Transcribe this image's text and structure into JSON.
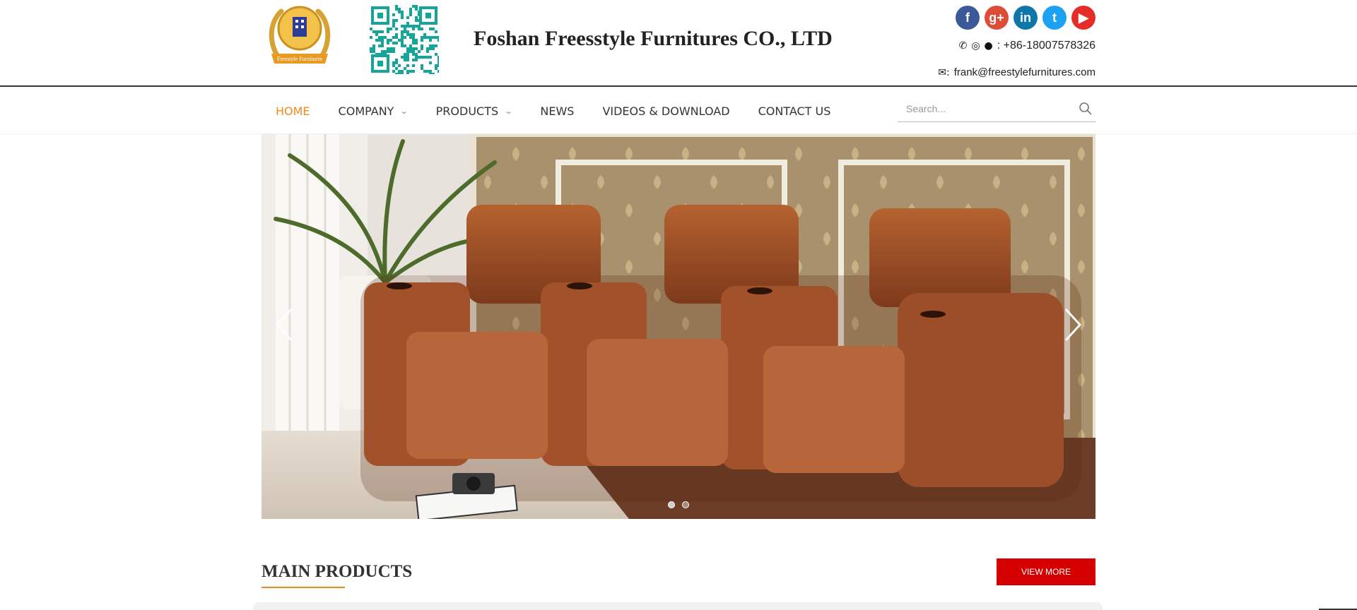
{
  "header": {
    "company_name": "Foshan Freesstyle Furnitures CO., LTD",
    "logo_text": "Freestyle Furnitures",
    "phone": ": +86-18007578326",
    "email": "frank@freestylefurnitures.com",
    "social": [
      {
        "name": "facebook-icon",
        "glyph": "f"
      },
      {
        "name": "google-plus-icon",
        "glyph": "g+"
      },
      {
        "name": "linkedin-icon",
        "glyph": "in"
      },
      {
        "name": "twitter-icon",
        "glyph": "t"
      },
      {
        "name": "youtube-icon",
        "glyph": "▶"
      }
    ]
  },
  "nav": {
    "items": [
      {
        "label": "HOME",
        "active": true,
        "dropdown": false
      },
      {
        "label": "COMPANY",
        "active": false,
        "dropdown": true
      },
      {
        "label": "PRODUCTS",
        "active": false,
        "dropdown": true
      },
      {
        "label": "NEWS",
        "active": false,
        "dropdown": false
      },
      {
        "label": "VIDEOS & DOWNLOAD",
        "active": false,
        "dropdown": false
      },
      {
        "label": "CONTACT US",
        "active": false,
        "dropdown": false
      }
    ],
    "search_placeholder": "Search..."
  },
  "banner": {
    "slides": 2,
    "active_slide": 1
  },
  "main_products": {
    "title": "MAIN PRODUCTS",
    "view_more_label": "VIEW MORE"
  },
  "colors": {
    "accent": "#f08c1b",
    "button": "#d40000",
    "leather": "#a3512a"
  }
}
